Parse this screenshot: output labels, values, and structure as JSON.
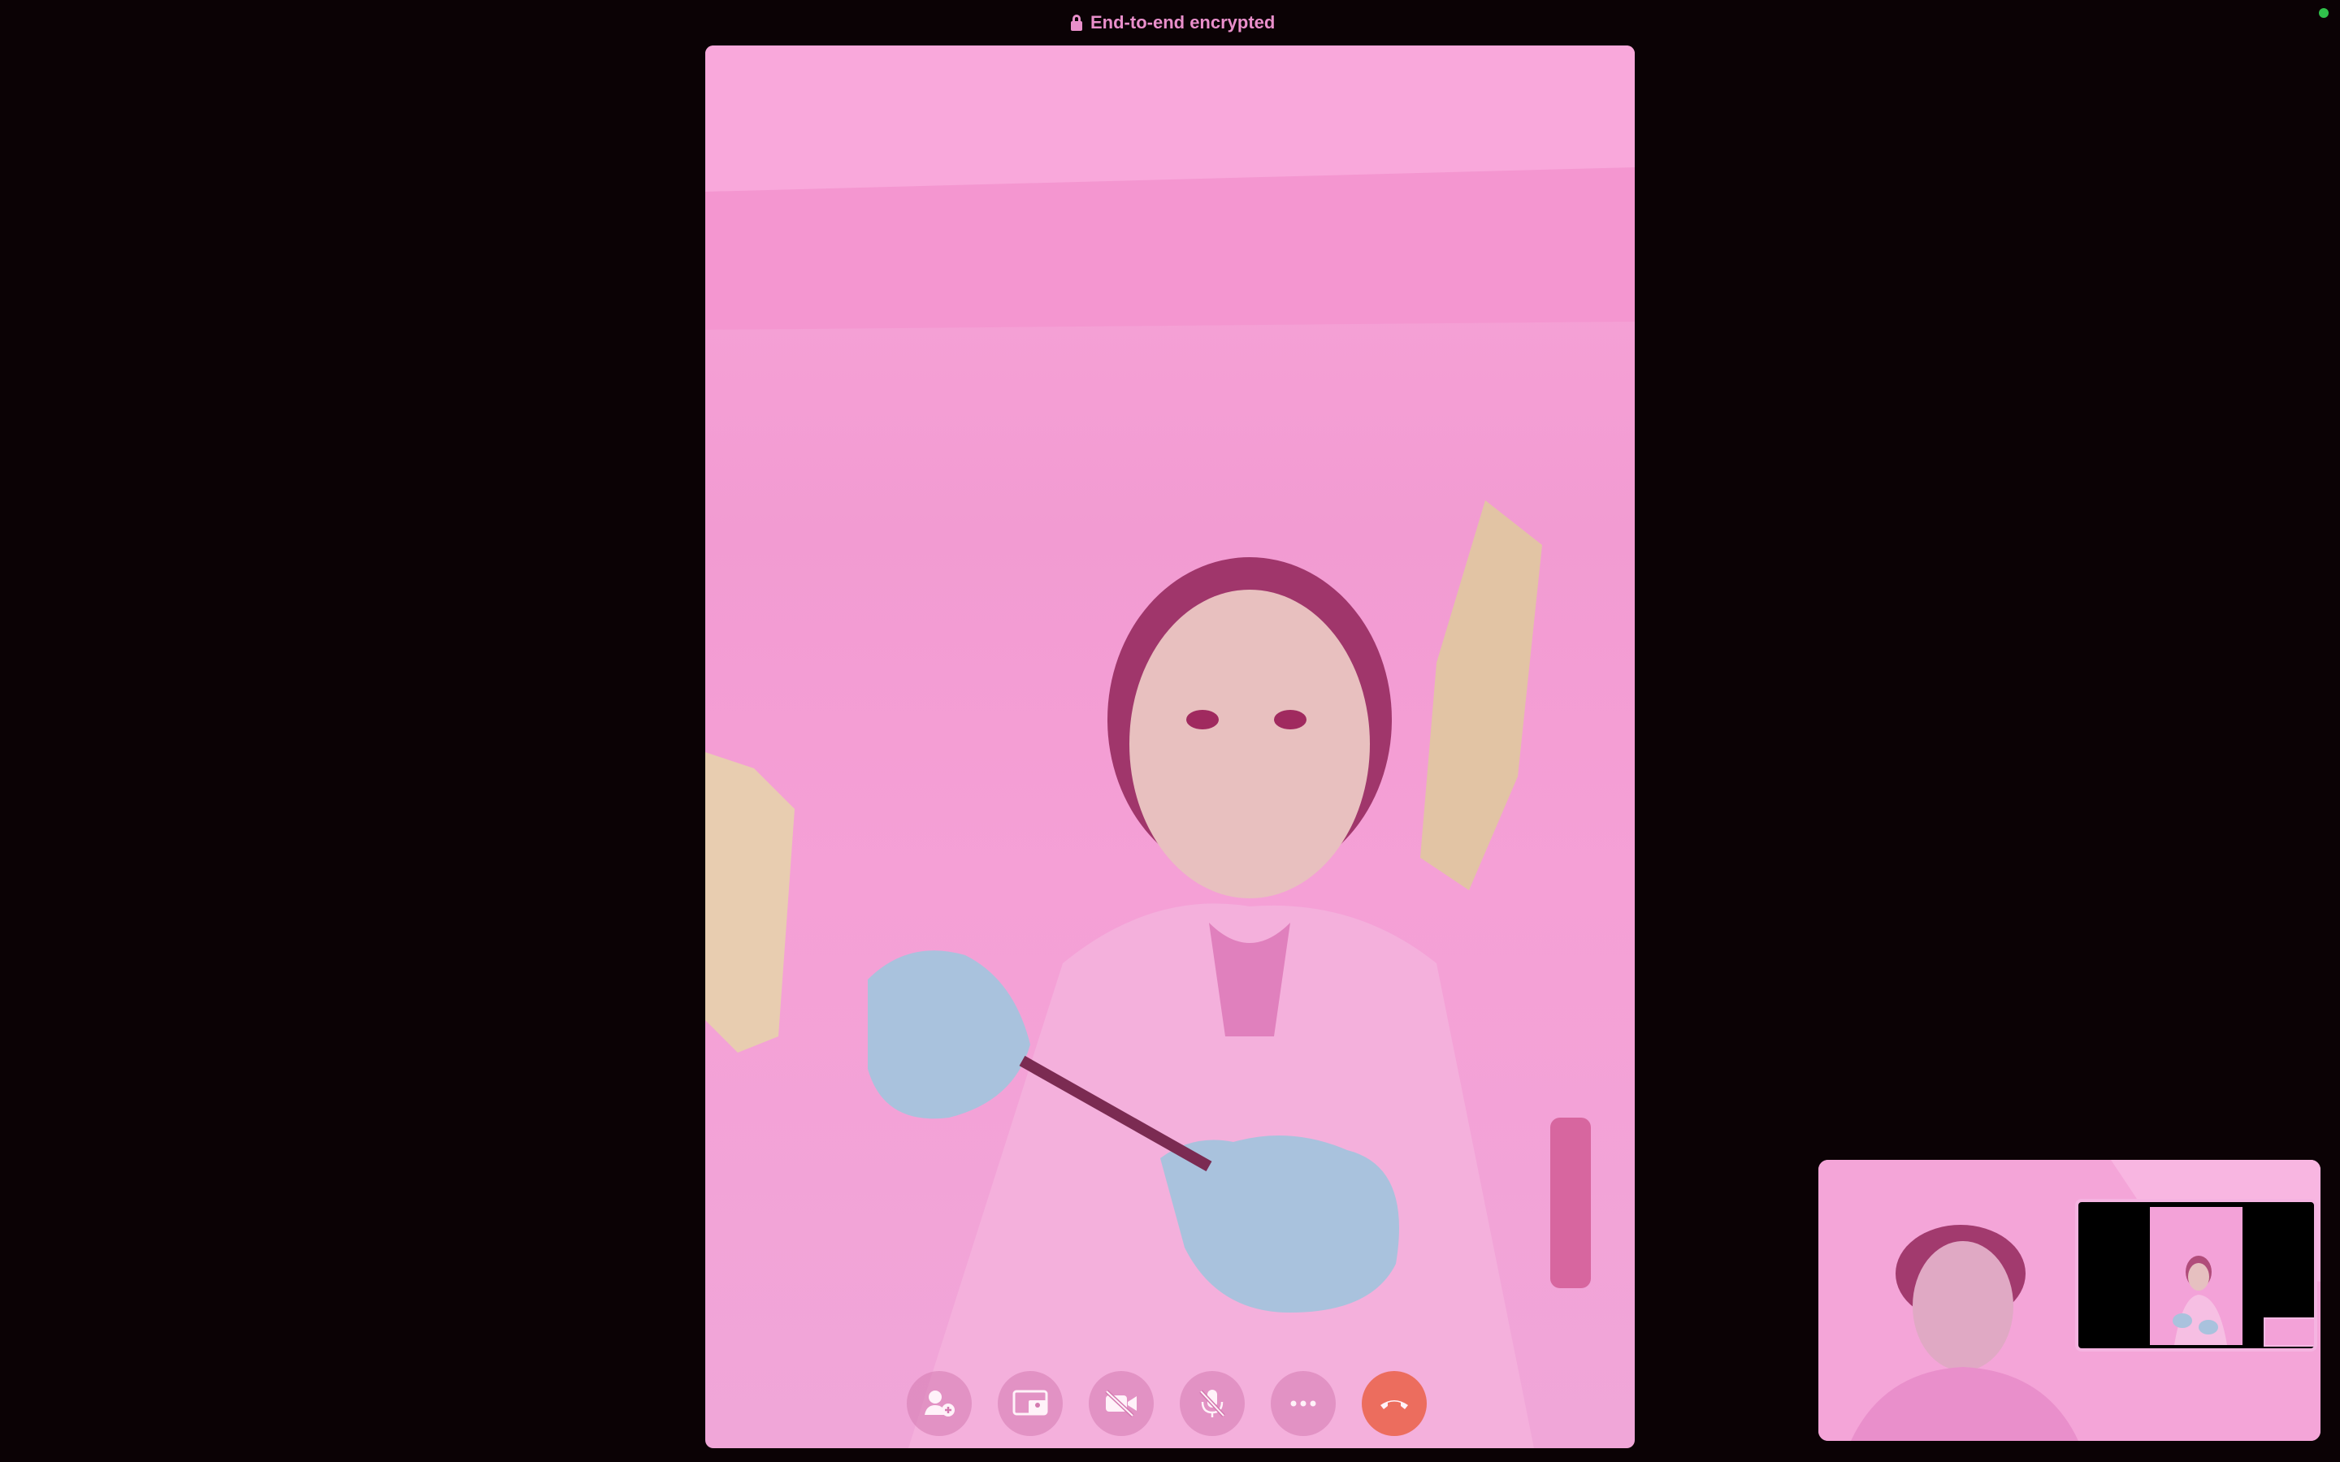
{
  "header": {
    "encryption_label": "End-to-end encrypted",
    "lock_icon": "lock-icon",
    "status_dot_color": "#30c24b"
  },
  "colors": {
    "background": "#0b0205",
    "accent": "#e98fcb",
    "video_tint": "#f29bd2",
    "end_call": "#ec6d5e"
  },
  "controls": [
    {
      "name": "add-person-button",
      "icon": "add-person-icon"
    },
    {
      "name": "share-screen-button",
      "icon": "screen-share-icon"
    },
    {
      "name": "camera-off-button",
      "icon": "camera-off-icon"
    },
    {
      "name": "mute-button",
      "icon": "mic-off-icon"
    },
    {
      "name": "more-button",
      "icon": "ellipsis-icon"
    },
    {
      "name": "end-call-button",
      "icon": "phone-hangup-icon"
    }
  ]
}
